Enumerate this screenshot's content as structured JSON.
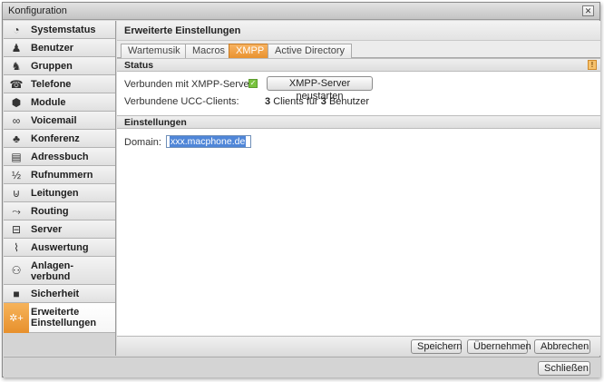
{
  "window": {
    "title": "Konfiguration",
    "close_glyph": "✕"
  },
  "sidebar": {
    "items": [
      {
        "label": "Systemstatus",
        "icon": "gauge-icon",
        "glyph": "◔"
      },
      {
        "label": "Benutzer",
        "icon": "user-icon",
        "glyph": "♟"
      },
      {
        "label": "Gruppen",
        "icon": "group-icon",
        "glyph": "♞"
      },
      {
        "label": "Telefone",
        "icon": "telephone-icon",
        "glyph": "☎"
      },
      {
        "label": "Module",
        "icon": "module-icon",
        "glyph": "⬢"
      },
      {
        "label": "Voicemail",
        "icon": "voicemail-icon",
        "glyph": "∞"
      },
      {
        "label": "Konferenz",
        "icon": "conference-icon",
        "glyph": "♣"
      },
      {
        "label": "Adressbuch",
        "icon": "addressbook-icon",
        "glyph": "▤"
      },
      {
        "label": "Rufnummern",
        "icon": "numbers-icon",
        "glyph": "½"
      },
      {
        "label": "Leitungen",
        "icon": "plug-icon",
        "glyph": "⊍"
      },
      {
        "label": "Routing",
        "icon": "routing-icon",
        "glyph": "⤳"
      },
      {
        "label": "Server",
        "icon": "server-icon",
        "glyph": "⊟"
      },
      {
        "label": "Auswertung",
        "icon": "chart-icon",
        "glyph": "⌇"
      },
      {
        "label": "Anlagen-verbund",
        "icon": "network-icon",
        "glyph": "⚇"
      },
      {
        "label": "Sicherheit",
        "icon": "lock-icon",
        "glyph": "■"
      },
      {
        "label": "Erweiterte Einstellungen",
        "icon": "gears-icon",
        "glyph": "✲+"
      }
    ]
  },
  "main": {
    "header": "Erweiterte Einstellungen",
    "tabs": [
      {
        "label": "Wartemusik"
      },
      {
        "label": "Macros"
      },
      {
        "label": "XMPP"
      },
      {
        "label": "Active Directory"
      }
    ],
    "status": {
      "heading": "Status",
      "info_glyph": "!",
      "connected_label": "Verbunden mit XMPP-Server:",
      "checkbox_glyph": "✓",
      "restart_button": "XMPP-Server neustarten",
      "clients_label": "Verbundene UCC-Clients:",
      "clients_count": "3",
      "clients_mid": "Clients für",
      "users_count": "3",
      "users_suffix": "Benutzer"
    },
    "settings": {
      "heading": "Einstellungen",
      "domain_label": "Domain:",
      "domain_value": "xxx.macphone.de"
    },
    "footer": {
      "save": "Speichern",
      "apply": "Übernehmen",
      "cancel": "Abbrechen"
    }
  },
  "window_footer": {
    "close_button": "Schließen"
  }
}
